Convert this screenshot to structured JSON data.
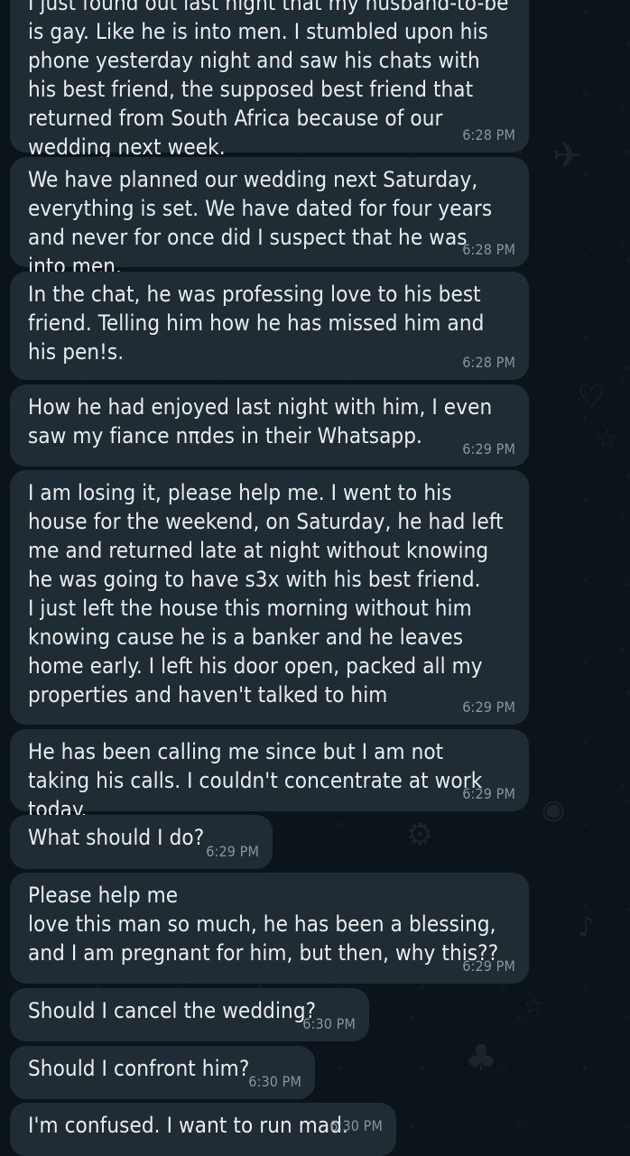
{
  "messages": [
    {
      "text": "I just found out last night that my husband-to-be is gay. Like he is into men. I stumbled upon his phone yesterday night and saw his chats with his best friend, the supposed best friend that returned from South Africa because of our wedding next week.",
      "time": "6:28 PM"
    },
    {
      "text": "We have planned our wedding next Saturday, everything is set. We have dated for four years and never for once did I suspect that he was into men.",
      "time": "6:28 PM"
    },
    {
      "text": "In the chat, he was professing love to his best friend. Telling him how he has missed him and his pen!s.",
      "time": "6:28 PM"
    },
    {
      "text": "How he had enjoyed last night with him, I even saw my fiance nπdes in their Whatsapp.",
      "time": "6:29 PM"
    },
    {
      "text": "I am losing it, please help me. I went to his house for the weekend, on Saturday, he had left me and returned late at night without knowing he was going to have s3x with his best friend.\nI just left the house this morning without him knowing cause he is a banker and he leaves home early. I left his door open, packed all my properties and haven't talked to him",
      "time": "6:29 PM"
    },
    {
      "text": "He has been calling me since but I am not taking his calls. I couldn't concentrate at work today.",
      "time": "6:29 PM"
    },
    {
      "text": "What should I do?",
      "time": "6:29 PM"
    },
    {
      "text": "Please help me\nlove this man so much, he has been a blessing, and I am pregnant for him, but then, why this??",
      "time": "6:29 PM"
    },
    {
      "text": "Should I cancel the wedding?",
      "time": "6:30 PM"
    },
    {
      "text": "Should I confront him?",
      "time": "6:30 PM"
    },
    {
      "text": "I'm confused. I want to run mad.",
      "time": "6:30 PM"
    }
  ]
}
